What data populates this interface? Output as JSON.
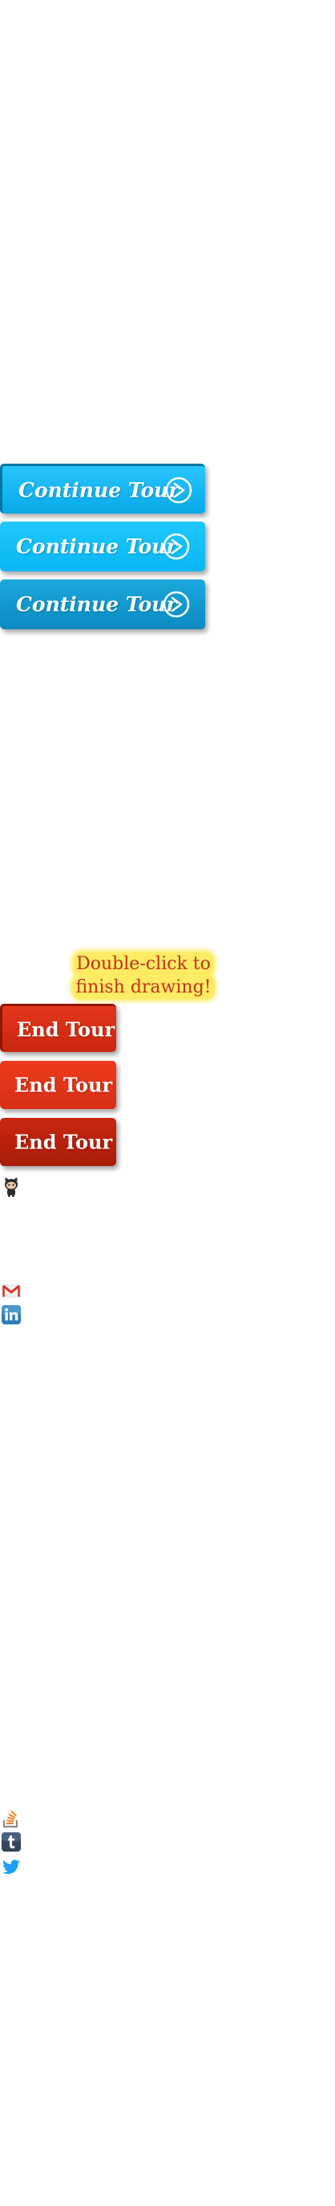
{
  "tour": {
    "continue_label": "Continue Tour",
    "end_label": "End Tour"
  },
  "tooltip": {
    "line1": "Double-click to",
    "line2": "finish drawing!"
  },
  "colors": {
    "continue_blue": "#08a9e8",
    "end_red": "#d72f14",
    "tooltip_bg": "#fdeb63",
    "tooltip_text": "#c0311c"
  },
  "social_icons": [
    "github-icon",
    "gmail-icon",
    "linkedin-icon",
    "stackoverflow-icon",
    "tumblr-icon",
    "twitter-icon"
  ]
}
